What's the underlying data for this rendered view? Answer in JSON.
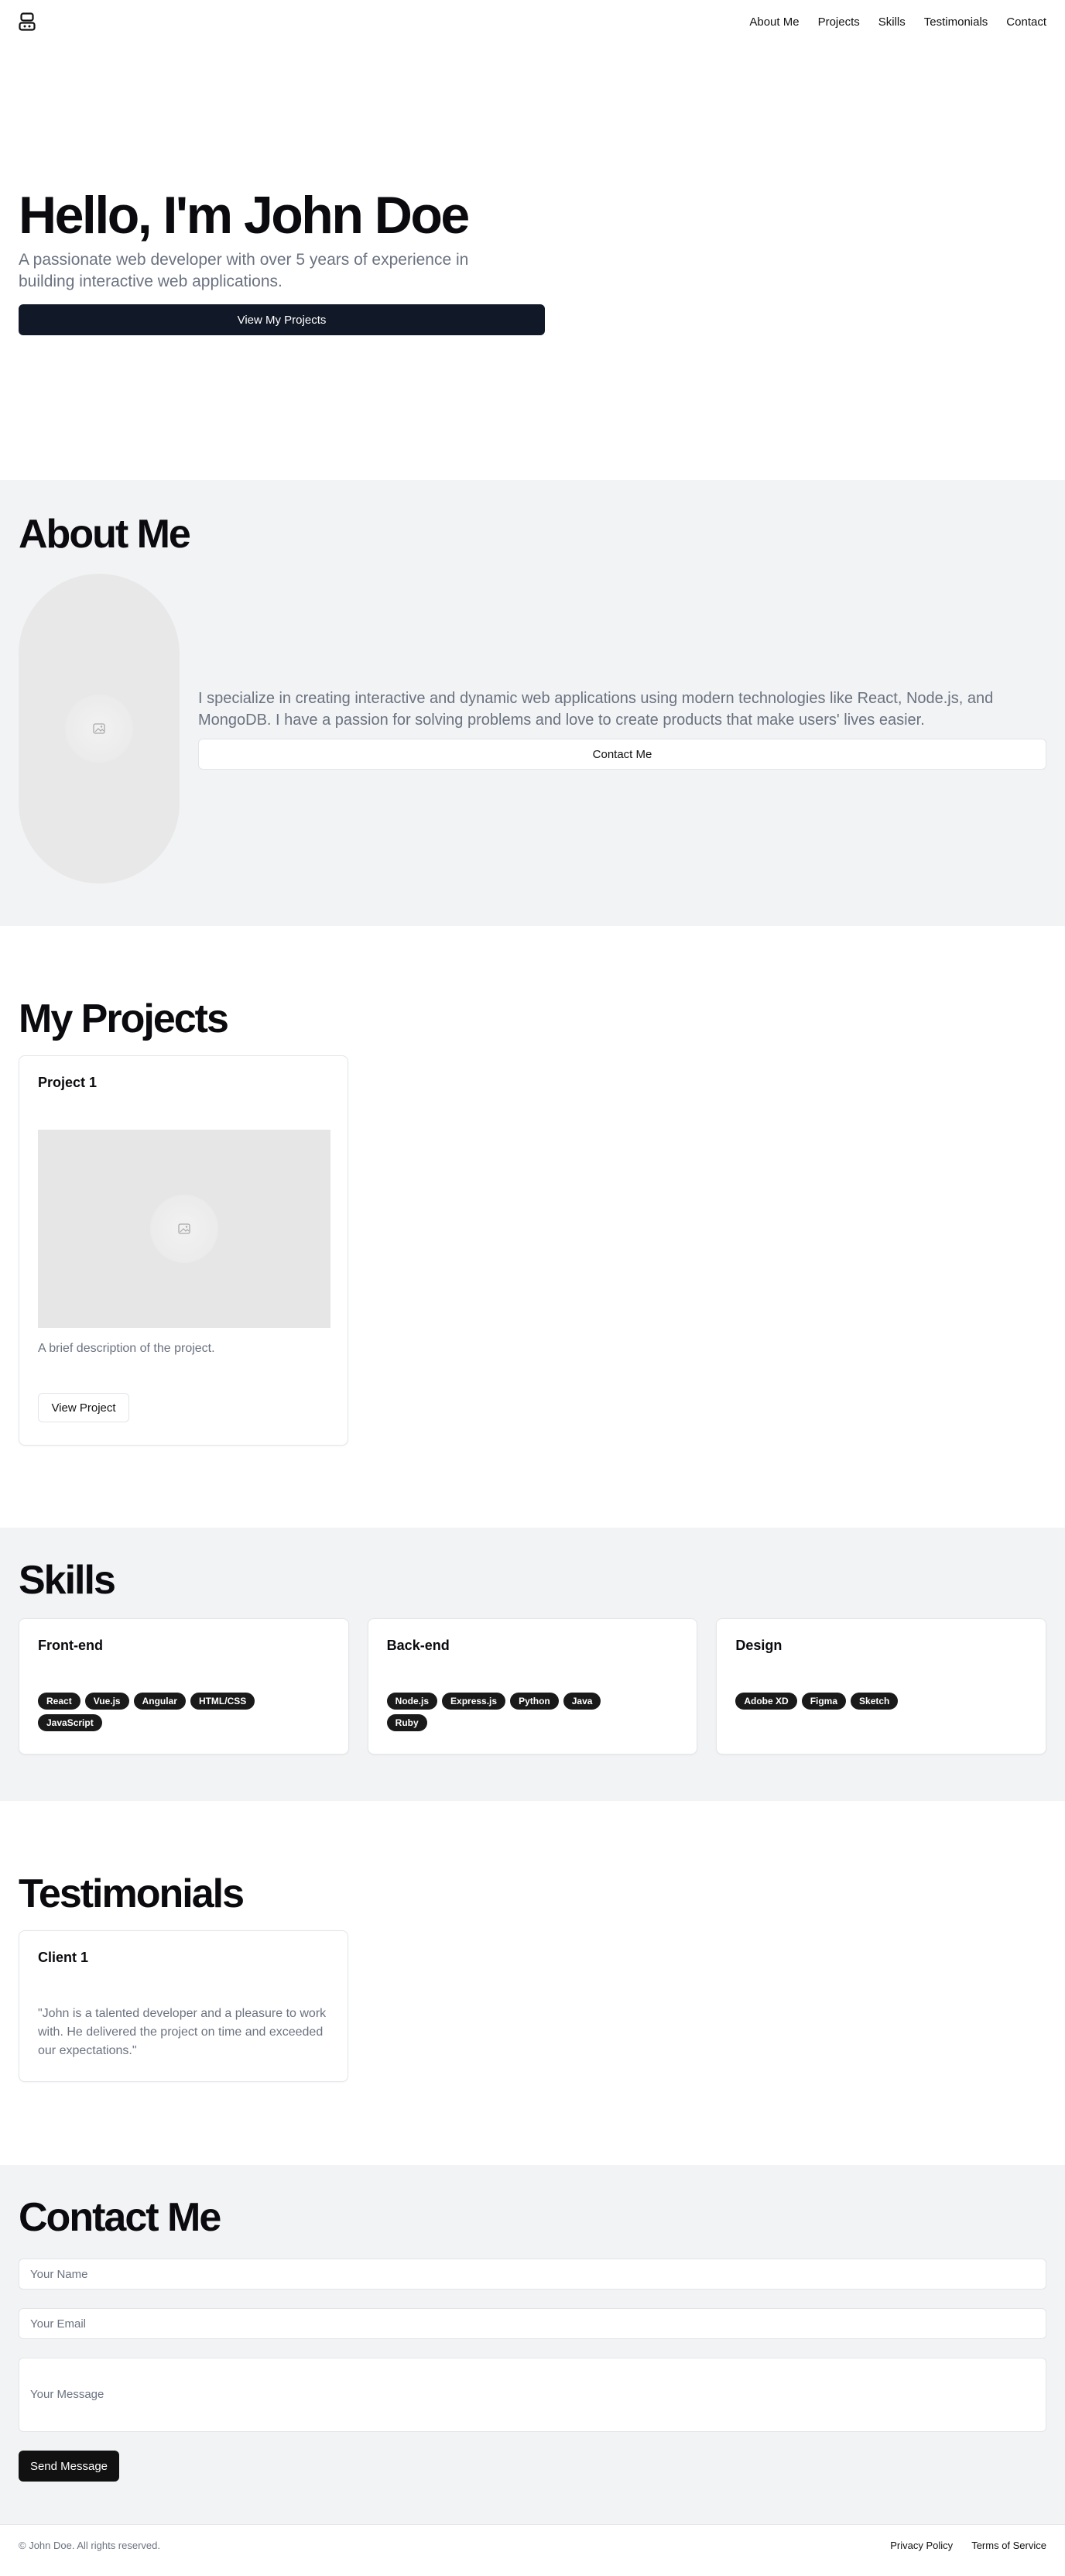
{
  "nav": {
    "logo_icon": "brand-logo-icon",
    "links": [
      "About Me",
      "Projects",
      "Skills",
      "Testimonials",
      "Contact"
    ]
  },
  "hero": {
    "title": "Hello, I'm John Doe",
    "subtitle": "A passionate web developer with over 5 years of experience in building interactive web applications.",
    "button": "View My Projects"
  },
  "about": {
    "title": "About Me",
    "photo_icon": "image-placeholder-icon",
    "text": "I specialize in creating interactive and dynamic web applications using modern technologies like React, Node.js, and MongoDB. I have a passion for solving problems and love to create products that make users' lives easier.",
    "button": "Contact Me"
  },
  "projects": {
    "title": "My Projects",
    "items": [
      {
        "title": "Project 1",
        "image_icon": "image-placeholder-icon",
        "description": "A brief description of the project.",
        "button": "View Project"
      }
    ]
  },
  "skills": {
    "title": "Skills",
    "groups": [
      {
        "title": "Front-end",
        "tags": [
          "React",
          "Vue.js",
          "Angular",
          "HTML/CSS",
          "JavaScript"
        ]
      },
      {
        "title": "Back-end",
        "tags": [
          "Node.js",
          "Express.js",
          "Python",
          "Java",
          "Ruby"
        ]
      },
      {
        "title": "Design",
        "tags": [
          "Adobe XD",
          "Figma",
          "Sketch"
        ]
      }
    ]
  },
  "testimonials": {
    "title": "Testimonials",
    "items": [
      {
        "client": "Client 1",
        "quote": "\"John is a talented developer and a pleasure to work with. He delivered the project on time and exceeded our expectations.\""
      }
    ]
  },
  "contact": {
    "title": "Contact Me",
    "name_placeholder": "Your Name",
    "email_placeholder": "Your Email",
    "message_placeholder": "Your Message",
    "button": "Send Message"
  },
  "footer": {
    "copyright": "© John Doe. All rights reserved.",
    "links": [
      "Privacy Policy",
      "Terms of Service"
    ]
  },
  "colors": {
    "primary_dark": "#111827",
    "section_gray": "#f2f3f4",
    "muted_text": "#6b7280",
    "tag_bg": "#1a1a1a"
  }
}
